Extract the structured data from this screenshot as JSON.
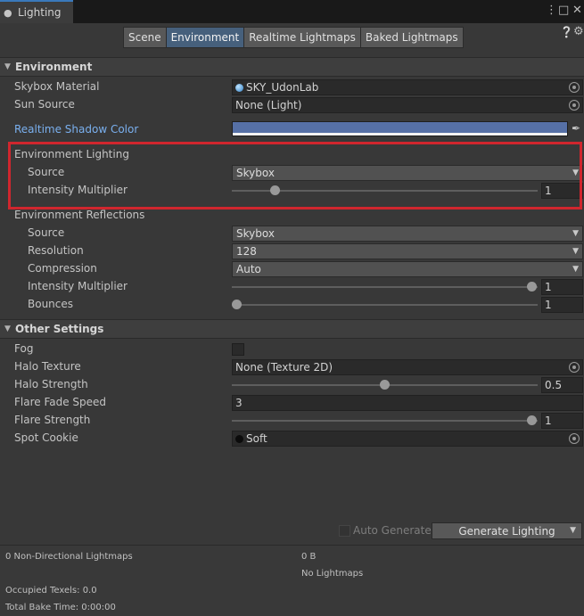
{
  "window": {
    "tab_title": "Lighting"
  },
  "toolbar": {
    "tabs": [
      {
        "label": "Scene",
        "active": false
      },
      {
        "label": "Environment",
        "active": true
      },
      {
        "label": "Realtime Lightmaps",
        "active": false
      },
      {
        "label": "Baked Lightmaps",
        "active": false
      }
    ]
  },
  "environment": {
    "header": "Environment",
    "skybox_material": {
      "label": "Skybox Material",
      "value": "SKY_UdonLab"
    },
    "sun_source": {
      "label": "Sun Source",
      "value": "None (Light)"
    },
    "realtime_shadow_color": {
      "label": "Realtime Shadow Color",
      "color": "#5670a6"
    },
    "lighting": {
      "header": "Environment Lighting",
      "source": {
        "label": "Source",
        "value": "Skybox"
      },
      "intensity": {
        "label": "Intensity Multiplier",
        "value": "1",
        "fraction": 0.13
      }
    },
    "reflections": {
      "header": "Environment Reflections",
      "source": {
        "label": "Source",
        "value": "Skybox"
      },
      "resolution": {
        "label": "Resolution",
        "value": "128"
      },
      "compression": {
        "label": "Compression",
        "value": "Auto"
      },
      "intensity": {
        "label": "Intensity Multiplier",
        "value": "1",
        "fraction": 1.0
      },
      "bounces": {
        "label": "Bounces",
        "value": "1",
        "fraction": 0.0
      }
    }
  },
  "other": {
    "header": "Other Settings",
    "fog": {
      "label": "Fog",
      "checked": false
    },
    "halo_texture": {
      "label": "Halo Texture",
      "value": "None (Texture 2D)"
    },
    "halo_strength": {
      "label": "Halo Strength",
      "value": "0.5",
      "fraction": 0.5
    },
    "flare_fade_speed": {
      "label": "Flare Fade Speed",
      "value": "3"
    },
    "flare_strength": {
      "label": "Flare Strength",
      "value": "1",
      "fraction": 1.0
    },
    "spot_cookie": {
      "label": "Spot Cookie",
      "value": "Soft"
    }
  },
  "bottom": {
    "auto_generate_label": "Auto Generate",
    "generate_label": "Generate Lighting"
  },
  "stats": {
    "lightmaps": "0 Non-Directional Lightmaps",
    "size": "0 B",
    "no_lightmaps": "No Lightmaps",
    "occupied": "Occupied Texels: 0.0",
    "bake_time": "Total Bake Time: 0:00:00"
  },
  "colors": {
    "accent": "#46607c",
    "highlight_box": "#d0262e"
  }
}
